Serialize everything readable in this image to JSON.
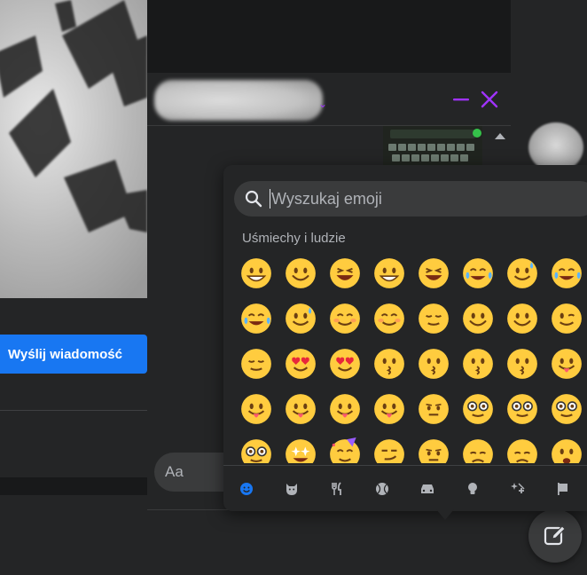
{
  "background": {
    "send_button": "Wyślij wiadomość"
  },
  "chat": {
    "input_placeholder": "Aa",
    "footer_icons": [
      "microphone-icon",
      "photo-icon",
      "sticker-icon",
      "gif-icon"
    ],
    "accent": "#a033ff"
  },
  "picker": {
    "search_placeholder": "Wyszukaj emoji",
    "category_label": "Uśmiechy i ludzie",
    "emojis": [
      "😀",
      "😃",
      "😄",
      "😁",
      "😆",
      "🥹",
      "😅",
      "😂",
      "🤣",
      "🥲",
      "☺️",
      "😊",
      "😇",
      "🙂",
      "🙃",
      "😉",
      "😌",
      "😍",
      "🥰",
      "😘",
      "😗",
      "😙",
      "😚",
      "😋",
      "😛",
      "😝",
      "😜",
      "🤪",
      "🤨",
      "🧐",
      "🤓",
      "😎",
      "🥸",
      "🤩",
      "🥳",
      "😏",
      "😒",
      "😞",
      "😔",
      "😟"
    ],
    "categories": [
      "smileys",
      "animals",
      "food",
      "activities",
      "travel",
      "objects",
      "symbols",
      "flags"
    ]
  },
  "colors": {
    "brand_blue": "#1877f2",
    "annotation_red": "#e0141e"
  }
}
